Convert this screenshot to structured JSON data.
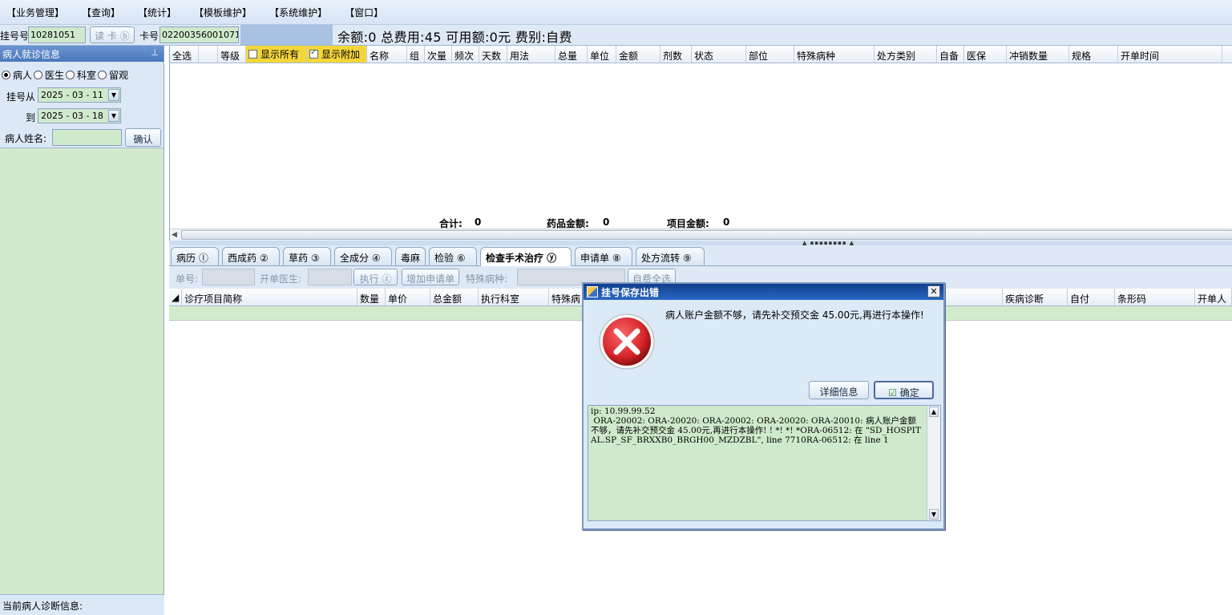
{
  "menu": [
    "【业务管理】",
    "【查询】",
    "【统计】",
    "【模板维护】",
    "【系统维护】",
    "【窗口】"
  ],
  "infobar": {
    "reg_label": "挂号号",
    "reg_value": "10281051",
    "read_card": "读 卡 ⓑ",
    "card_label": "卡号",
    "card_value": "022003560010714",
    "summary": "余额:0 总费用:45 可用额:0元 费别:自费"
  },
  "left": {
    "title": "病人就诊信息",
    "pin": "ᖘ",
    "radios": [
      "病人",
      "医生",
      "科室",
      "留观"
    ],
    "from_label": "挂号从",
    "from_date": "2025 - 03 - 11",
    "to_label": "到",
    "to_date": "2025 - 03 - 18",
    "name_label": "病人姓名:",
    "confirm": "确认",
    "footer": "当前病人诊断信息:"
  },
  "top_grid": {
    "columns": [
      "全选",
      "",
      "等级",
      "显示所有",
      "显示附加",
      "名称",
      "组",
      "次量",
      "频次",
      "天数",
      "用法",
      "总量",
      "单位",
      "金额",
      "剂数",
      "状态",
      "部位",
      "特殊病种",
      "处方类别",
      "自备",
      "医保",
      "冲销数量",
      "规格",
      "开单时间"
    ],
    "total_label": "合计:",
    "total_value": "0",
    "drug_label": "药品金额:",
    "drug_value": "0",
    "item_label": "项目金额:",
    "item_value": "0"
  },
  "tabs": [
    "病历 ⓛ",
    "西成药 ②",
    "草药 ③",
    "全成分 ④",
    "毒麻",
    "检验 ⑥",
    "检查手术治疗 ⓨ",
    "申请单 ⑧",
    "处方流转 ⑨"
  ],
  "toolbar": {
    "order_label": "单号:",
    "doctor_label": "开单医生:",
    "exec": "执行 ⓩ",
    "add_request": "增加申请单",
    "special_label": "特殊病种:",
    "self_pay_all": "自费全选"
  },
  "bottom_grid": {
    "columns": [
      "诊疗项目简称",
      "数量",
      "单价",
      "总金额",
      "执行科室",
      "特殊病",
      "疾病诊断",
      "自付",
      "条形码",
      "开单人"
    ]
  },
  "dialog": {
    "title": "挂号保存出错",
    "message": " 病人账户金额不够，请先补交预交金 45.00元,再进行本操作!",
    "details_button": "详细信息",
    "ok_button": "确定",
    "detail_text": "ip: 10.99.99.52\n ORA-20002: ORA-20020: ORA-20002: ORA-20020: ORA-20010: 病人账户金额不够，请先补交预交金 45.00元,再进行本操作! ! *! *! *ORA-06512: 在 \"SD_HOSPITAL.SP_SF_BRXXB0_BRGH00_MZDZBL\", line 7710RA-06512: 在 line 1",
    "error_color": "#d9262b"
  }
}
